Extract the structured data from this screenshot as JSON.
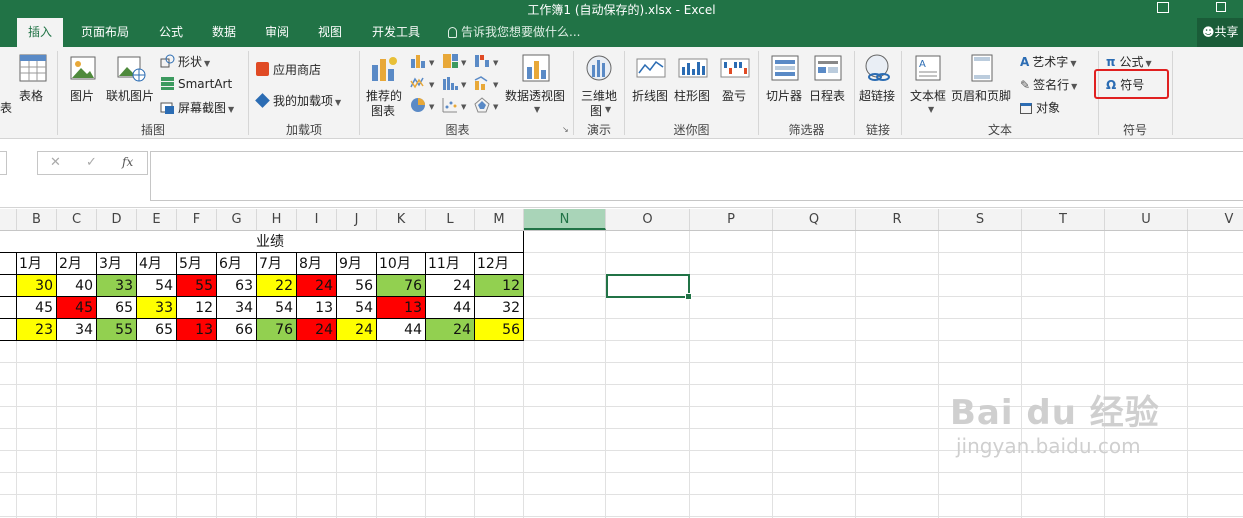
{
  "window": {
    "title": "工作簿1 (自动保存的).xlsx - Excel"
  },
  "tabs": [
    {
      "label": "插入",
      "active": true
    },
    {
      "label": "页面布局"
    },
    {
      "label": "公式"
    },
    {
      "label": "数据"
    },
    {
      "label": "审阅"
    },
    {
      "label": "视图"
    },
    {
      "label": "开发工具"
    }
  ],
  "tell_me": "告诉我您想要做什么...",
  "share_label": "共享",
  "ribbon": {
    "tables": {
      "table_partial": "表",
      "table": "表格"
    },
    "illustrations": {
      "picture": "图片",
      "online_picture": "联机图片",
      "shapes": "形状",
      "smartart": "SmartArt",
      "screenshot": "屏幕截图",
      "label": "插图"
    },
    "addins": {
      "store": "应用商店",
      "my_addins": "我的加载项",
      "label": "加载项"
    },
    "charts": {
      "recommended_line1": "推荐的",
      "recommended_line2": "图表",
      "pivot_chart": "数据透视图",
      "label": "图表"
    },
    "tours": {
      "map_line1": "三维地",
      "map_line2": "图",
      "label": "演示"
    },
    "sparklines": {
      "line": "折线图",
      "column": "柱形图",
      "winloss": "盈亏",
      "label": "迷你图"
    },
    "filters": {
      "slicer": "切片器",
      "timeline": "日程表",
      "label": "筛选器"
    },
    "links": {
      "hyperlink": "超链接",
      "label": "链接"
    },
    "text": {
      "textbox": "文本框",
      "header_footer": "页眉和页脚",
      "wordart": "艺术字",
      "signature": "签名行",
      "object": "对象",
      "label": "文本"
    },
    "symbols": {
      "equation": "公式",
      "symbol": "符号",
      "label": "符号"
    }
  },
  "formula_bar": {
    "cancel": "✕",
    "enter": "✓",
    "fx": "fx",
    "value": ""
  },
  "columns": [
    "B",
    "C",
    "D",
    "E",
    "F",
    "G",
    "H",
    "I",
    "J",
    "K",
    "L",
    "M",
    "N",
    "O",
    "P",
    "Q",
    "R",
    "S",
    "T",
    "U",
    "V"
  ],
  "selected_column": "N",
  "sheet": {
    "title": "业绩",
    "months": [
      "1月",
      "2月",
      "3月",
      "4月",
      "5月",
      "6月",
      "7月",
      "8月",
      "9月",
      "10月",
      "11月",
      "12月"
    ],
    "rows": [
      {
        "values": [
          30,
          40,
          33,
          54,
          55,
          63,
          22,
          24,
          56,
          76,
          24,
          12
        ],
        "colors": [
          "yellow",
          "white",
          "green",
          "white",
          "red",
          "white",
          "yellow",
          "red",
          "white",
          "green",
          "white",
          "green"
        ]
      },
      {
        "values": [
          45,
          45,
          65,
          33,
          12,
          34,
          54,
          13,
          54,
          13,
          44,
          32
        ],
        "colors": [
          "white",
          "red",
          "white",
          "yellow",
          "white",
          "white",
          "white",
          "white",
          "white",
          "red",
          "white",
          "white"
        ]
      },
      {
        "values": [
          23,
          34,
          55,
          65,
          13,
          66,
          76,
          24,
          24,
          44,
          24,
          56
        ],
        "colors": [
          "yellow",
          "white",
          "green",
          "white",
          "red",
          "white",
          "green",
          "red",
          "yellow",
          "white",
          "green",
          "yellow"
        ]
      }
    ],
    "palette": {
      "yellow": "#ffff00",
      "green": "#92d050",
      "red": "#ff0000",
      "white": "#ffffff"
    }
  },
  "watermark": {
    "brand": "Bai du 经验",
    "url": "jingyan.baidu.com"
  }
}
